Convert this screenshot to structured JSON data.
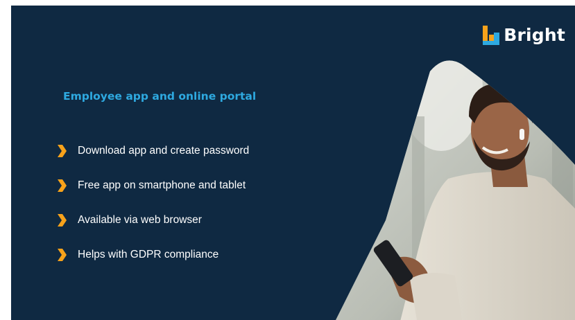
{
  "brand": {
    "name": "Bright",
    "accent_color": "#f7a21b",
    "background_color": "#0f2942",
    "heading_color": "#2ea9e0"
  },
  "slide": {
    "heading": "Employee app and online portal",
    "bullets": [
      {
        "text": "Download app and create password",
        "icon": "chevron-right-icon"
      },
      {
        "text": "Free app on smartphone and tablet",
        "icon": "chevron-right-icon"
      },
      {
        "text": "Available via web browser",
        "icon": "chevron-right-icon"
      },
      {
        "text": "Helps with GDPR compliance",
        "icon": "chevron-right-icon"
      }
    ]
  }
}
